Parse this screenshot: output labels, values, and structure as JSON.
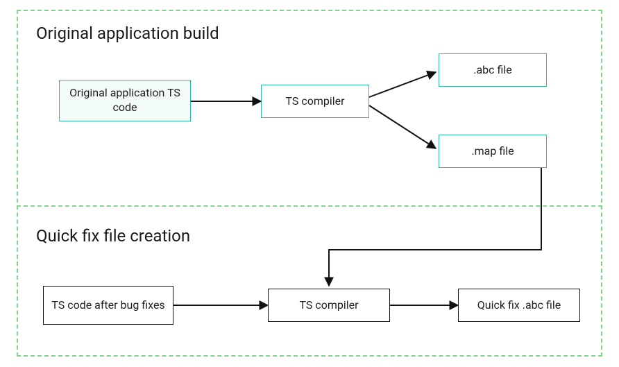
{
  "colors": {
    "region_border": "#7fd38a",
    "region_sep": "#7fd38a",
    "teal": "#2fb9a3",
    "black": "#111111"
  },
  "regions": {
    "top": {
      "title": "Original application build"
    },
    "bottom": {
      "title": "Quick fix file creation"
    }
  },
  "nodes": {
    "ts_code_orig": "Original application TS code",
    "ts_compiler_top": "TS compiler",
    "abc_file": ".abc file",
    "map_file": ".map file",
    "ts_code_fixed": "TS code after bug fixes",
    "ts_compiler_bottom": "TS compiler",
    "quick_fix_abc": "Quick fix .abc file"
  }
}
